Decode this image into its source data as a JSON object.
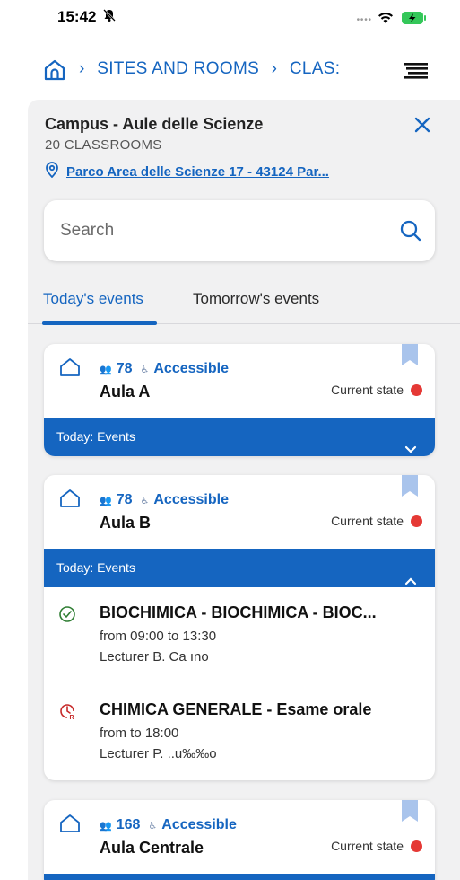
{
  "status": {
    "time": "15:42"
  },
  "breadcrumb": {
    "items": [
      "SITES AND ROOMS",
      "CLAS:"
    ]
  },
  "campus": {
    "title": "Campus - Aule delle Scienze",
    "subtitle": "20 CLASSROOMS",
    "address": "Parco Area delle Scienze 17 - 43124 Par..."
  },
  "search": {
    "placeholder": "Search"
  },
  "tabs": [
    {
      "label": "Today's events",
      "active": true
    },
    {
      "label": "Tomorrow's events",
      "active": false
    }
  ],
  "rooms": [
    {
      "capacity": "78",
      "accessible": "Accessible",
      "name": "Aula A",
      "state_label": "Current state",
      "events_label": "Today: Events",
      "expanded": false
    },
    {
      "capacity": "78",
      "accessible": "Accessible",
      "name": "Aula B",
      "state_label": "Current state",
      "events_label": "Today: Events",
      "expanded": true,
      "events": [
        {
          "title": "BIOCHIMICA - BIOCHIMICA - BIOC...",
          "time": "from 09:00 to 13:30",
          "lecturer": "Lecturer B. Ca            ıno",
          "status": "done"
        },
        {
          "title": "CHIMICA GENERALE - Esame orale",
          "time": "from          to 18:00",
          "lecturer": "Lecturer P. ..u‰‰o",
          "status": "scheduled"
        }
      ]
    },
    {
      "capacity": "168",
      "accessible": "Accessible",
      "name": "Aula Centrale",
      "state_label": "Current state",
      "expanded": false
    }
  ],
  "colors": {
    "accent": "#1565c0",
    "state_red": "#e53935",
    "done_green": "#2e7d32",
    "event_red": "#c62828"
  }
}
